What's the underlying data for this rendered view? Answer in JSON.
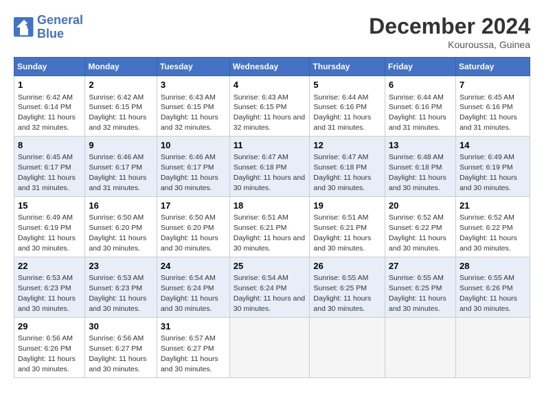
{
  "logo": {
    "line1": "General",
    "line2": "Blue"
  },
  "title": "December 2024",
  "subtitle": "Kouroussa, Guinea",
  "days_of_week": [
    "Sunday",
    "Monday",
    "Tuesday",
    "Wednesday",
    "Thursday",
    "Friday",
    "Saturday"
  ],
  "weeks": [
    [
      {
        "day": "1",
        "sunrise": "6:42 AM",
        "sunset": "6:14 PM",
        "daylight": "11 hours and 32 minutes."
      },
      {
        "day": "2",
        "sunrise": "6:42 AM",
        "sunset": "6:15 PM",
        "daylight": "11 hours and 32 minutes."
      },
      {
        "day": "3",
        "sunrise": "6:43 AM",
        "sunset": "6:15 PM",
        "daylight": "11 hours and 32 minutes."
      },
      {
        "day": "4",
        "sunrise": "6:43 AM",
        "sunset": "6:15 PM",
        "daylight": "11 hours and 32 minutes."
      },
      {
        "day": "5",
        "sunrise": "6:44 AM",
        "sunset": "6:16 PM",
        "daylight": "11 hours and 31 minutes."
      },
      {
        "day": "6",
        "sunrise": "6:44 AM",
        "sunset": "6:16 PM",
        "daylight": "11 hours and 31 minutes."
      },
      {
        "day": "7",
        "sunrise": "6:45 AM",
        "sunset": "6:16 PM",
        "daylight": "11 hours and 31 minutes."
      }
    ],
    [
      {
        "day": "8",
        "sunrise": "6:45 AM",
        "sunset": "6:17 PM",
        "daylight": "11 hours and 31 minutes."
      },
      {
        "day": "9",
        "sunrise": "6:46 AM",
        "sunset": "6:17 PM",
        "daylight": "11 hours and 31 minutes."
      },
      {
        "day": "10",
        "sunrise": "6:46 AM",
        "sunset": "6:17 PM",
        "daylight": "11 hours and 30 minutes."
      },
      {
        "day": "11",
        "sunrise": "6:47 AM",
        "sunset": "6:18 PM",
        "daylight": "11 hours and 30 minutes."
      },
      {
        "day": "12",
        "sunrise": "6:47 AM",
        "sunset": "6:18 PM",
        "daylight": "11 hours and 30 minutes."
      },
      {
        "day": "13",
        "sunrise": "6:48 AM",
        "sunset": "6:18 PM",
        "daylight": "11 hours and 30 minutes."
      },
      {
        "day": "14",
        "sunrise": "6:49 AM",
        "sunset": "6:19 PM",
        "daylight": "11 hours and 30 minutes."
      }
    ],
    [
      {
        "day": "15",
        "sunrise": "6:49 AM",
        "sunset": "6:19 PM",
        "daylight": "11 hours and 30 minutes."
      },
      {
        "day": "16",
        "sunrise": "6:50 AM",
        "sunset": "6:20 PM",
        "daylight": "11 hours and 30 minutes."
      },
      {
        "day": "17",
        "sunrise": "6:50 AM",
        "sunset": "6:20 PM",
        "daylight": "11 hours and 30 minutes."
      },
      {
        "day": "18",
        "sunrise": "6:51 AM",
        "sunset": "6:21 PM",
        "daylight": "11 hours and 30 minutes."
      },
      {
        "day": "19",
        "sunrise": "6:51 AM",
        "sunset": "6:21 PM",
        "daylight": "11 hours and 30 minutes."
      },
      {
        "day": "20",
        "sunrise": "6:52 AM",
        "sunset": "6:22 PM",
        "daylight": "11 hours and 30 minutes."
      },
      {
        "day": "21",
        "sunrise": "6:52 AM",
        "sunset": "6:22 PM",
        "daylight": "11 hours and 30 minutes."
      }
    ],
    [
      {
        "day": "22",
        "sunrise": "6:53 AM",
        "sunset": "6:23 PM",
        "daylight": "11 hours and 30 minutes."
      },
      {
        "day": "23",
        "sunrise": "6:53 AM",
        "sunset": "6:23 PM",
        "daylight": "11 hours and 30 minutes."
      },
      {
        "day": "24",
        "sunrise": "6:54 AM",
        "sunset": "6:24 PM",
        "daylight": "11 hours and 30 minutes."
      },
      {
        "day": "25",
        "sunrise": "6:54 AM",
        "sunset": "6:24 PM",
        "daylight": "11 hours and 30 minutes."
      },
      {
        "day": "26",
        "sunrise": "6:55 AM",
        "sunset": "6:25 PM",
        "daylight": "11 hours and 30 minutes."
      },
      {
        "day": "27",
        "sunrise": "6:55 AM",
        "sunset": "6:25 PM",
        "daylight": "11 hours and 30 minutes."
      },
      {
        "day": "28",
        "sunrise": "6:55 AM",
        "sunset": "6:26 PM",
        "daylight": "11 hours and 30 minutes."
      }
    ],
    [
      {
        "day": "29",
        "sunrise": "6:56 AM",
        "sunset": "6:26 PM",
        "daylight": "11 hours and 30 minutes."
      },
      {
        "day": "30",
        "sunrise": "6:56 AM",
        "sunset": "6:27 PM",
        "daylight": "11 hours and 30 minutes."
      },
      {
        "day": "31",
        "sunrise": "6:57 AM",
        "sunset": "6:27 PM",
        "daylight": "11 hours and 30 minutes."
      },
      null,
      null,
      null,
      null
    ]
  ]
}
